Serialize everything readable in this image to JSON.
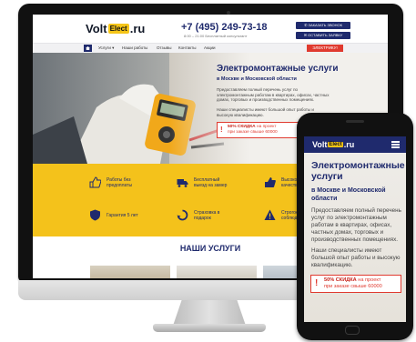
{
  "desktop": {
    "logo": {
      "left": "Volt",
      "badge": "Elect",
      "right": ".ru"
    },
    "header": {
      "phone": "+7 (495) 249-73-18",
      "hours": "8:00 – 21:00   Бесплатный консультант",
      "button_callback": "✆ ЗАКАЗАТЬ ЗВОНОК",
      "button_request": "✉ ОСТАВИТЬ ЗАЯВКУ"
    },
    "nav": {
      "items": [
        "Услуги ▾",
        "Наши работы",
        "Отзывы",
        "Контакты",
        "Акции"
      ],
      "cta": "ЭЛЕКТРИКУ!"
    },
    "hero": {
      "title": "Электромонтажные услуги",
      "subtitle": "в Москве и Московской области",
      "text1": "Предоставляем полный перечень услуг по электромонтажным работам в квартирах, офисах, частных домах, торговых и производственных помещениях.",
      "text2": "Наши специалисты имеют большой опыт работы и высокую квалификацию.",
      "promo_bold": "50% СКИДКА",
      "promo_rest": "на проект",
      "promo_line2": "при заказе свыше 60000"
    },
    "features": [
      {
        "icon": "thumbs-up-icon",
        "text": "Работы без предоплаты"
      },
      {
        "icon": "truck-icon",
        "text": "Бесплатный выезд на замер"
      },
      {
        "icon": "like-icon",
        "text": "Высокое качество"
      },
      {
        "icon": "shield-icon",
        "text": "Гарантия 5 лет"
      },
      {
        "icon": "recycle-icon",
        "text": "Страховка в подарок"
      },
      {
        "icon": "warning-icon",
        "text": "Строгое соблюдение"
      }
    ],
    "services_title": "НАШИ УСЛУГИ"
  },
  "mobile": {
    "logo": {
      "left": "Volt",
      "badge": "Elect",
      "right": ".ru"
    },
    "title": "Электромонтажные услуги",
    "subtitle": "в Москве и Московской области",
    "text1": "Предоставляем полный перечень услуг по электромонтажным работам в квартирах, офисах, частных домах, торговых и производственных помещениях.",
    "text2": "Наши специалисты имеют большой опыт работы и высокую квалификацию.",
    "promo_bold": "50% СКИДКА",
    "promo_rest": "на проект",
    "promo_line2": "при заказе свыше 60000"
  },
  "colors": {
    "brand_blue": "#1f2a6d",
    "accent_yellow": "#f4c21b",
    "alert_red": "#e03a2f"
  }
}
